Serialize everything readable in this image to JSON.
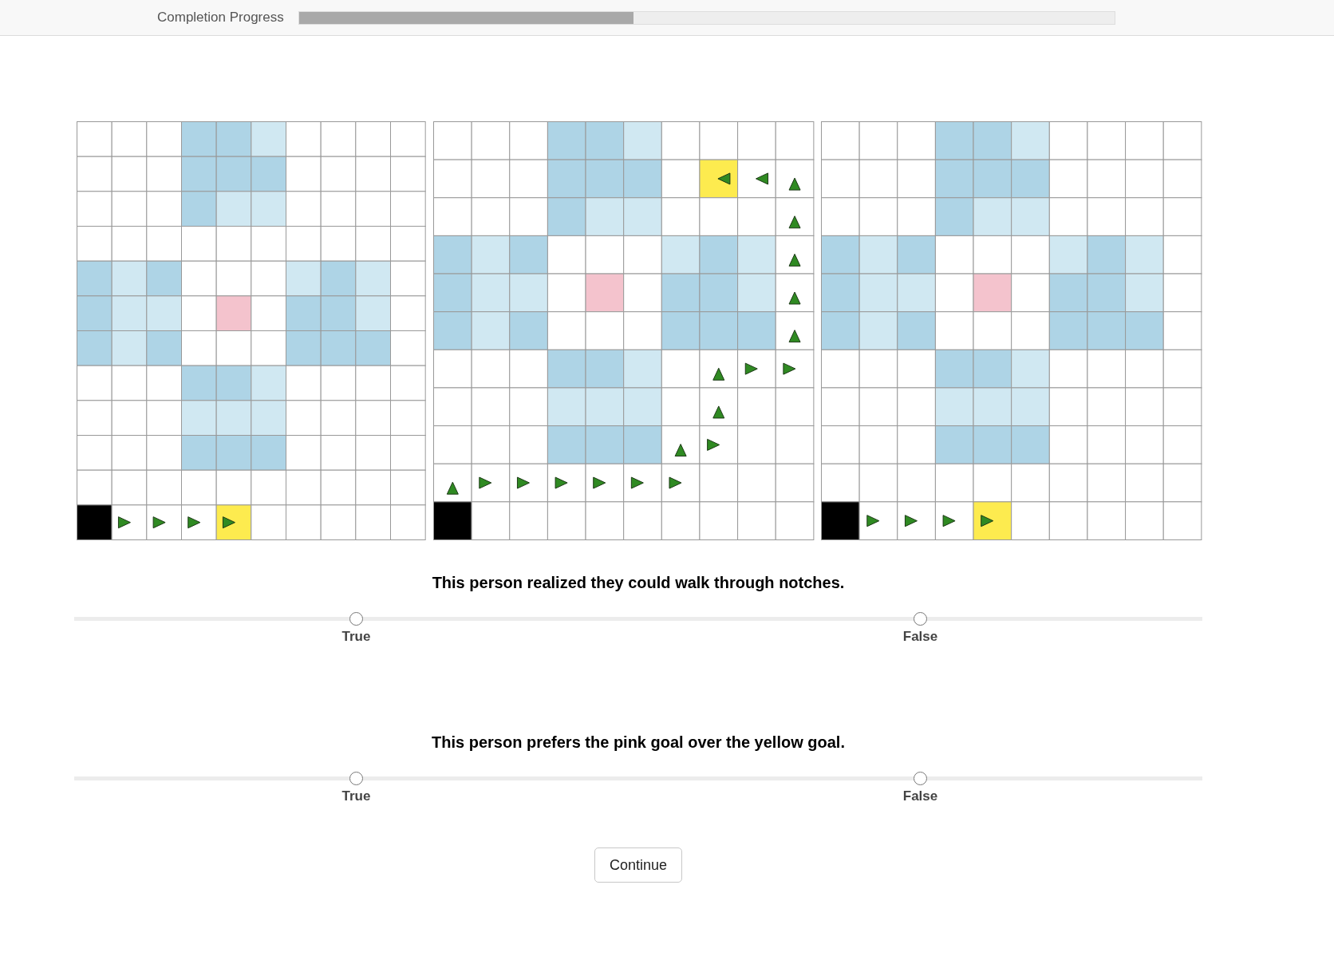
{
  "progress": {
    "label": "Completion Progress",
    "level": 0.41
  },
  "grids": [
    {
      "rows": [
        [
          {
            "color": "#ffffff",
            "kind": "plain"
          },
          {
            "color": "#ffffff",
            "kind": "plain"
          },
          {
            "color": "#ffffff",
            "kind": "plain"
          },
          {
            "color": "#aed4e6",
            "kind": "plain"
          },
          {
            "color": "#aed4e6",
            "kind": "plain"
          },
          {
            "color": "#d0e8f2",
            "kind": "plain"
          },
          {
            "color": "#ffffff",
            "kind": "plain"
          },
          {
            "color": "#ffffff",
            "kind": "plain"
          },
          {
            "color": "#ffffff",
            "kind": "plain"
          },
          {
            "color": "#ffffff",
            "kind": "plain"
          }
        ],
        [
          {
            "color": "#ffffff",
            "kind": "plain"
          },
          {
            "color": "#ffffff",
            "kind": "plain"
          },
          {
            "color": "#ffffff",
            "kind": "plain"
          },
          {
            "color": "#aed4e6",
            "kind": "plain"
          },
          {
            "color": "#aed4e6",
            "kind": "plain"
          },
          {
            "color": "#aed4e6",
            "kind": "plain"
          },
          {
            "color": "#ffffff",
            "kind": "plain"
          },
          {
            "color": "#ffffff",
            "kind": "plain"
          },
          {
            "color": "#ffffff",
            "kind": "plain"
          },
          {
            "color": "#ffffff",
            "kind": "plain"
          }
        ],
        [
          {
            "color": "#ffffff",
            "kind": "plain"
          },
          {
            "color": "#ffffff",
            "kind": "plain"
          },
          {
            "color": "#ffffff",
            "kind": "plain"
          },
          {
            "color": "#aed4e6",
            "kind": "plain"
          },
          {
            "color": "#d0e8f2",
            "kind": "plain"
          },
          {
            "color": "#d0e8f2",
            "kind": "plain"
          },
          {
            "color": "#ffffff",
            "kind": "plain"
          },
          {
            "color": "#ffffff",
            "kind": "plain"
          },
          {
            "color": "#ffffff",
            "kind": "plain"
          },
          {
            "color": "#ffffff",
            "kind": "plain"
          }
        ],
        [
          {
            "color": "#ffffff",
            "kind": "plain"
          },
          {
            "color": "#ffffff",
            "kind": "plain"
          },
          {
            "color": "#ffffff",
            "kind": "plain"
          },
          {
            "color": "#ffffff",
            "kind": "plain"
          },
          {
            "color": "#ffffff",
            "kind": "plain"
          },
          {
            "color": "#ffffff",
            "kind": "plain"
          },
          {
            "color": "#ffffff",
            "kind": "plain"
          },
          {
            "color": "#ffffff",
            "kind": "plain"
          },
          {
            "color": "#ffffff",
            "kind": "plain"
          },
          {
            "color": "#ffffff",
            "kind": "plain"
          }
        ],
        [
          {
            "color": "#aed4e6",
            "kind": "plain"
          },
          {
            "color": "#d0e8f2",
            "kind": "plain"
          },
          {
            "color": "#aed4e6",
            "kind": "plain"
          },
          {
            "color": "#ffffff",
            "kind": "plain"
          },
          {
            "color": "#ffffff",
            "kind": "plain"
          },
          {
            "color": "#ffffff",
            "kind": "plain"
          },
          {
            "color": "#d0e8f2",
            "kind": "plain"
          },
          {
            "color": "#aed4e6",
            "kind": "plain"
          },
          {
            "color": "#d0e8f2",
            "kind": "plain"
          },
          {
            "color": "#ffffff",
            "kind": "plain"
          }
        ],
        [
          {
            "color": "#aed4e6",
            "kind": "plain"
          },
          {
            "color": "#d0e8f2",
            "kind": "plain"
          },
          {
            "color": "#d0e8f2",
            "kind": "plain"
          },
          {
            "color": "#ffffff",
            "kind": "plain"
          },
          {
            "color": "#f4c3cd",
            "kind": "plain"
          },
          {
            "color": "#ffffff",
            "kind": "plain"
          },
          {
            "color": "#aed4e6",
            "kind": "plain"
          },
          {
            "color": "#aed4e6",
            "kind": "plain"
          },
          {
            "color": "#d0e8f2",
            "kind": "plain"
          },
          {
            "color": "#ffffff",
            "kind": "plain"
          }
        ],
        [
          {
            "color": "#aed4e6",
            "kind": "plain"
          },
          {
            "color": "#d0e8f2",
            "kind": "plain"
          },
          {
            "color": "#aed4e6",
            "kind": "plain"
          },
          {
            "color": "#ffffff",
            "kind": "plain"
          },
          {
            "color": "#ffffff",
            "kind": "plain"
          },
          {
            "color": "#ffffff",
            "kind": "plain"
          },
          {
            "color": "#aed4e6",
            "kind": "plain"
          },
          {
            "color": "#aed4e6",
            "kind": "plain"
          },
          {
            "color": "#aed4e6",
            "kind": "plain"
          },
          {
            "color": "#ffffff",
            "kind": "plain"
          }
        ],
        [
          {
            "color": "#ffffff",
            "kind": "plain"
          },
          {
            "color": "#ffffff",
            "kind": "plain"
          },
          {
            "color": "#ffffff",
            "kind": "plain"
          },
          {
            "color": "#aed4e6",
            "kind": "plain"
          },
          {
            "color": "#aed4e6",
            "kind": "plain"
          },
          {
            "color": "#d0e8f2",
            "kind": "plain"
          },
          {
            "color": "#ffffff",
            "kind": "plain"
          },
          {
            "color": "#ffffff",
            "kind": "plain"
          },
          {
            "color": "#ffffff",
            "kind": "plain"
          },
          {
            "color": "#ffffff",
            "kind": "plain"
          }
        ],
        [
          {
            "color": "#ffffff",
            "kind": "plain"
          },
          {
            "color": "#ffffff",
            "kind": "plain"
          },
          {
            "color": "#ffffff",
            "kind": "plain"
          },
          {
            "color": "#d0e8f2",
            "kind": "plain"
          },
          {
            "color": "#d0e8f2",
            "kind": "plain"
          },
          {
            "color": "#d0e8f2",
            "kind": "plain"
          },
          {
            "color": "#ffffff",
            "kind": "plain"
          },
          {
            "color": "#ffffff",
            "kind": "plain"
          },
          {
            "color": "#ffffff",
            "kind": "plain"
          },
          {
            "color": "#ffffff",
            "kind": "plain"
          }
        ],
        [
          {
            "color": "#ffffff",
            "kind": "plain"
          },
          {
            "color": "#ffffff",
            "kind": "plain"
          },
          {
            "color": "#ffffff",
            "kind": "plain"
          },
          {
            "color": "#aed4e6",
            "kind": "plain"
          },
          {
            "color": "#aed4e6",
            "kind": "plain"
          },
          {
            "color": "#aed4e6",
            "kind": "plain"
          },
          {
            "color": "#ffffff",
            "kind": "plain"
          },
          {
            "color": "#ffffff",
            "kind": "plain"
          },
          {
            "color": "#ffffff",
            "kind": "plain"
          },
          {
            "color": "#ffffff",
            "kind": "plain"
          }
        ],
        [
          {
            "color": "#ffffff",
            "kind": "plain"
          },
          {
            "color": "#ffffff",
            "kind": "plain"
          },
          {
            "color": "#ffffff",
            "kind": "plain"
          },
          {
            "color": "#ffffff",
            "kind": "plain"
          },
          {
            "color": "#ffffff",
            "kind": "plain"
          },
          {
            "color": "#ffffff",
            "kind": "plain"
          },
          {
            "color": "#ffffff",
            "kind": "plain"
          },
          {
            "color": "#ffffff",
            "kind": "plain"
          },
          {
            "color": "#ffffff",
            "kind": "plain"
          },
          {
            "color": "#ffffff",
            "kind": "plain"
          }
        ],
        [
          {
            "color": "#000000",
            "kind": "plain"
          },
          {
            "color": "#ffffff",
            "kind": "right"
          },
          {
            "color": "#ffffff",
            "kind": "right"
          },
          {
            "color": "#ffffff",
            "kind": "right"
          },
          {
            "color": "#fdeb4f",
            "kind": "right"
          },
          {
            "color": "#ffffff",
            "kind": "plain"
          },
          {
            "color": "#ffffff",
            "kind": "plain"
          },
          {
            "color": "#ffffff",
            "kind": "plain"
          },
          {
            "color": "#ffffff",
            "kind": "plain"
          },
          {
            "color": "#ffffff",
            "kind": "plain"
          }
        ]
      ]
    },
    {
      "rows": [
        [
          {
            "color": "#ffffff",
            "kind": "plain"
          },
          {
            "color": "#ffffff",
            "kind": "plain"
          },
          {
            "color": "#ffffff",
            "kind": "plain"
          },
          {
            "color": "#aed4e6",
            "kind": "plain"
          },
          {
            "color": "#aed4e6",
            "kind": "plain"
          },
          {
            "color": "#d0e8f2",
            "kind": "plain"
          },
          {
            "color": "#ffffff",
            "kind": "plain"
          },
          {
            "color": "#ffffff",
            "kind": "plain"
          },
          {
            "color": "#ffffff",
            "kind": "plain"
          },
          {
            "color": "#ffffff",
            "kind": "plain"
          }
        ],
        [
          {
            "color": "#ffffff",
            "kind": "plain"
          },
          {
            "color": "#ffffff",
            "kind": "plain"
          },
          {
            "color": "#ffffff",
            "kind": "plain"
          },
          {
            "color": "#aed4e6",
            "kind": "plain"
          },
          {
            "color": "#aed4e6",
            "kind": "plain"
          },
          {
            "color": "#aed4e6",
            "kind": "plain"
          },
          {
            "color": "#ffffff",
            "kind": "plain"
          },
          {
            "color": "#fdeb4f",
            "kind": "left"
          },
          {
            "color": "#ffffff",
            "kind": "left"
          },
          {
            "color": "#ffffff",
            "kind": "up"
          }
        ],
        [
          {
            "color": "#ffffff",
            "kind": "plain"
          },
          {
            "color": "#ffffff",
            "kind": "plain"
          },
          {
            "color": "#ffffff",
            "kind": "plain"
          },
          {
            "color": "#aed4e6",
            "kind": "plain"
          },
          {
            "color": "#d0e8f2",
            "kind": "plain"
          },
          {
            "color": "#d0e8f2",
            "kind": "plain"
          },
          {
            "color": "#ffffff",
            "kind": "plain"
          },
          {
            "color": "#ffffff",
            "kind": "plain"
          },
          {
            "color": "#ffffff",
            "kind": "plain"
          },
          {
            "color": "#ffffff",
            "kind": "up"
          }
        ],
        [
          {
            "color": "#aed4e6",
            "kind": "plain"
          },
          {
            "color": "#d0e8f2",
            "kind": "plain"
          },
          {
            "color": "#aed4e6",
            "kind": "plain"
          },
          {
            "color": "#ffffff",
            "kind": "plain"
          },
          {
            "color": "#ffffff",
            "kind": "plain"
          },
          {
            "color": "#ffffff",
            "kind": "plain"
          },
          {
            "color": "#d0e8f2",
            "kind": "plain"
          },
          {
            "color": "#aed4e6",
            "kind": "plain"
          },
          {
            "color": "#d0e8f2",
            "kind": "plain"
          },
          {
            "color": "#ffffff",
            "kind": "up"
          }
        ],
        [
          {
            "color": "#aed4e6",
            "kind": "plain"
          },
          {
            "color": "#d0e8f2",
            "kind": "plain"
          },
          {
            "color": "#d0e8f2",
            "kind": "plain"
          },
          {
            "color": "#ffffff",
            "kind": "plain"
          },
          {
            "color": "#f4c3cd",
            "kind": "plain"
          },
          {
            "color": "#ffffff",
            "kind": "plain"
          },
          {
            "color": "#aed4e6",
            "kind": "plain"
          },
          {
            "color": "#aed4e6",
            "kind": "plain"
          },
          {
            "color": "#d0e8f2",
            "kind": "plain"
          },
          {
            "color": "#ffffff",
            "kind": "up"
          }
        ],
        [
          {
            "color": "#aed4e6",
            "kind": "plain"
          },
          {
            "color": "#d0e8f2",
            "kind": "plain"
          },
          {
            "color": "#aed4e6",
            "kind": "plain"
          },
          {
            "color": "#ffffff",
            "kind": "plain"
          },
          {
            "color": "#ffffff",
            "kind": "plain"
          },
          {
            "color": "#ffffff",
            "kind": "plain"
          },
          {
            "color": "#aed4e6",
            "kind": "plain"
          },
          {
            "color": "#aed4e6",
            "kind": "plain"
          },
          {
            "color": "#aed4e6",
            "kind": "plain"
          },
          {
            "color": "#ffffff",
            "kind": "up"
          }
        ],
        [
          {
            "color": "#ffffff",
            "kind": "plain"
          },
          {
            "color": "#ffffff",
            "kind": "plain"
          },
          {
            "color": "#ffffff",
            "kind": "plain"
          },
          {
            "color": "#aed4e6",
            "kind": "plain"
          },
          {
            "color": "#aed4e6",
            "kind": "plain"
          },
          {
            "color": "#d0e8f2",
            "kind": "plain"
          },
          {
            "color": "#ffffff",
            "kind": "plain"
          },
          {
            "color": "#ffffff",
            "kind": "up"
          },
          {
            "color": "#ffffff",
            "kind": "right"
          },
          {
            "color": "#ffffff",
            "kind": "right"
          }
        ],
        [
          {
            "color": "#ffffff",
            "kind": "plain"
          },
          {
            "color": "#ffffff",
            "kind": "plain"
          },
          {
            "color": "#ffffff",
            "kind": "plain"
          },
          {
            "color": "#d0e8f2",
            "kind": "plain"
          },
          {
            "color": "#d0e8f2",
            "kind": "plain"
          },
          {
            "color": "#d0e8f2",
            "kind": "plain"
          },
          {
            "color": "#ffffff",
            "kind": "plain"
          },
          {
            "color": "#ffffff",
            "kind": "up"
          },
          {
            "color": "#ffffff",
            "kind": "plain"
          },
          {
            "color": "#ffffff",
            "kind": "plain"
          }
        ],
        [
          {
            "color": "#ffffff",
            "kind": "plain"
          },
          {
            "color": "#ffffff",
            "kind": "plain"
          },
          {
            "color": "#ffffff",
            "kind": "plain"
          },
          {
            "color": "#aed4e6",
            "kind": "plain"
          },
          {
            "color": "#aed4e6",
            "kind": "plain"
          },
          {
            "color": "#aed4e6",
            "kind": "plain"
          },
          {
            "color": "#ffffff",
            "kind": "up"
          },
          {
            "color": "#ffffff",
            "kind": "right"
          },
          {
            "color": "#ffffff",
            "kind": "plain"
          },
          {
            "color": "#ffffff",
            "kind": "plain"
          }
        ],
        [
          {
            "color": "#ffffff",
            "kind": "up"
          },
          {
            "color": "#ffffff",
            "kind": "right"
          },
          {
            "color": "#ffffff",
            "kind": "right"
          },
          {
            "color": "#ffffff",
            "kind": "right"
          },
          {
            "color": "#ffffff",
            "kind": "right"
          },
          {
            "color": "#ffffff",
            "kind": "right"
          },
          {
            "color": "#ffffff",
            "kind": "right"
          },
          {
            "color": "#ffffff",
            "kind": "plain"
          },
          {
            "color": "#ffffff",
            "kind": "plain"
          },
          {
            "color": "#ffffff",
            "kind": "plain"
          }
        ],
        [
          {
            "color": "#000000",
            "kind": "plain"
          },
          {
            "color": "#ffffff",
            "kind": "plain"
          },
          {
            "color": "#ffffff",
            "kind": "plain"
          },
          {
            "color": "#ffffff",
            "kind": "plain"
          },
          {
            "color": "#ffffff",
            "kind": "plain"
          },
          {
            "color": "#ffffff",
            "kind": "plain"
          },
          {
            "color": "#ffffff",
            "kind": "plain"
          },
          {
            "color": "#ffffff",
            "kind": "plain"
          },
          {
            "color": "#ffffff",
            "kind": "plain"
          },
          {
            "color": "#ffffff",
            "kind": "plain"
          }
        ]
      ]
    },
    {
      "rows": [
        [
          {
            "color": "#ffffff",
            "kind": "plain"
          },
          {
            "color": "#ffffff",
            "kind": "plain"
          },
          {
            "color": "#ffffff",
            "kind": "plain"
          },
          {
            "color": "#aed4e6",
            "kind": "plain"
          },
          {
            "color": "#aed4e6",
            "kind": "plain"
          },
          {
            "color": "#d0e8f2",
            "kind": "plain"
          },
          {
            "color": "#ffffff",
            "kind": "plain"
          },
          {
            "color": "#ffffff",
            "kind": "plain"
          },
          {
            "color": "#ffffff",
            "kind": "plain"
          },
          {
            "color": "#ffffff",
            "kind": "plain"
          }
        ],
        [
          {
            "color": "#ffffff",
            "kind": "plain"
          },
          {
            "color": "#ffffff",
            "kind": "plain"
          },
          {
            "color": "#ffffff",
            "kind": "plain"
          },
          {
            "color": "#aed4e6",
            "kind": "plain"
          },
          {
            "color": "#aed4e6",
            "kind": "plain"
          },
          {
            "color": "#aed4e6",
            "kind": "plain"
          },
          {
            "color": "#ffffff",
            "kind": "plain"
          },
          {
            "color": "#ffffff",
            "kind": "plain"
          },
          {
            "color": "#ffffff",
            "kind": "plain"
          },
          {
            "color": "#ffffff",
            "kind": "plain"
          }
        ],
        [
          {
            "color": "#ffffff",
            "kind": "plain"
          },
          {
            "color": "#ffffff",
            "kind": "plain"
          },
          {
            "color": "#ffffff",
            "kind": "plain"
          },
          {
            "color": "#aed4e6",
            "kind": "plain"
          },
          {
            "color": "#d0e8f2",
            "kind": "plain"
          },
          {
            "color": "#d0e8f2",
            "kind": "plain"
          },
          {
            "color": "#ffffff",
            "kind": "plain"
          },
          {
            "color": "#ffffff",
            "kind": "plain"
          },
          {
            "color": "#ffffff",
            "kind": "plain"
          },
          {
            "color": "#ffffff",
            "kind": "plain"
          }
        ],
        [
          {
            "color": "#aed4e6",
            "kind": "plain"
          },
          {
            "color": "#d0e8f2",
            "kind": "plain"
          },
          {
            "color": "#aed4e6",
            "kind": "plain"
          },
          {
            "color": "#ffffff",
            "kind": "plain"
          },
          {
            "color": "#ffffff",
            "kind": "plain"
          },
          {
            "color": "#ffffff",
            "kind": "plain"
          },
          {
            "color": "#d0e8f2",
            "kind": "plain"
          },
          {
            "color": "#aed4e6",
            "kind": "plain"
          },
          {
            "color": "#d0e8f2",
            "kind": "plain"
          },
          {
            "color": "#ffffff",
            "kind": "plain"
          }
        ],
        [
          {
            "color": "#aed4e6",
            "kind": "plain"
          },
          {
            "color": "#d0e8f2",
            "kind": "plain"
          },
          {
            "color": "#d0e8f2",
            "kind": "plain"
          },
          {
            "color": "#ffffff",
            "kind": "plain"
          },
          {
            "color": "#f4c3cd",
            "kind": "plain"
          },
          {
            "color": "#ffffff",
            "kind": "plain"
          },
          {
            "color": "#aed4e6",
            "kind": "plain"
          },
          {
            "color": "#aed4e6",
            "kind": "plain"
          },
          {
            "color": "#d0e8f2",
            "kind": "plain"
          },
          {
            "color": "#ffffff",
            "kind": "plain"
          }
        ],
        [
          {
            "color": "#aed4e6",
            "kind": "plain"
          },
          {
            "color": "#d0e8f2",
            "kind": "plain"
          },
          {
            "color": "#aed4e6",
            "kind": "plain"
          },
          {
            "color": "#ffffff",
            "kind": "plain"
          },
          {
            "color": "#ffffff",
            "kind": "plain"
          },
          {
            "color": "#ffffff",
            "kind": "plain"
          },
          {
            "color": "#aed4e6",
            "kind": "plain"
          },
          {
            "color": "#aed4e6",
            "kind": "plain"
          },
          {
            "color": "#aed4e6",
            "kind": "plain"
          },
          {
            "color": "#ffffff",
            "kind": "plain"
          }
        ],
        [
          {
            "color": "#ffffff",
            "kind": "plain"
          },
          {
            "color": "#ffffff",
            "kind": "plain"
          },
          {
            "color": "#ffffff",
            "kind": "plain"
          },
          {
            "color": "#aed4e6",
            "kind": "plain"
          },
          {
            "color": "#aed4e6",
            "kind": "plain"
          },
          {
            "color": "#d0e8f2",
            "kind": "plain"
          },
          {
            "color": "#ffffff",
            "kind": "plain"
          },
          {
            "color": "#ffffff",
            "kind": "plain"
          },
          {
            "color": "#ffffff",
            "kind": "plain"
          },
          {
            "color": "#ffffff",
            "kind": "plain"
          }
        ],
        [
          {
            "color": "#ffffff",
            "kind": "plain"
          },
          {
            "color": "#ffffff",
            "kind": "plain"
          },
          {
            "color": "#ffffff",
            "kind": "plain"
          },
          {
            "color": "#d0e8f2",
            "kind": "plain"
          },
          {
            "color": "#d0e8f2",
            "kind": "plain"
          },
          {
            "color": "#d0e8f2",
            "kind": "plain"
          },
          {
            "color": "#ffffff",
            "kind": "plain"
          },
          {
            "color": "#ffffff",
            "kind": "plain"
          },
          {
            "color": "#ffffff",
            "kind": "plain"
          },
          {
            "color": "#ffffff",
            "kind": "plain"
          }
        ],
        [
          {
            "color": "#ffffff",
            "kind": "plain"
          },
          {
            "color": "#ffffff",
            "kind": "plain"
          },
          {
            "color": "#ffffff",
            "kind": "plain"
          },
          {
            "color": "#aed4e6",
            "kind": "plain"
          },
          {
            "color": "#aed4e6",
            "kind": "plain"
          },
          {
            "color": "#aed4e6",
            "kind": "plain"
          },
          {
            "color": "#ffffff",
            "kind": "plain"
          },
          {
            "color": "#ffffff",
            "kind": "plain"
          },
          {
            "color": "#ffffff",
            "kind": "plain"
          },
          {
            "color": "#ffffff",
            "kind": "plain"
          }
        ],
        [
          {
            "color": "#ffffff",
            "kind": "plain"
          },
          {
            "color": "#ffffff",
            "kind": "plain"
          },
          {
            "color": "#ffffff",
            "kind": "plain"
          },
          {
            "color": "#ffffff",
            "kind": "plain"
          },
          {
            "color": "#ffffff",
            "kind": "plain"
          },
          {
            "color": "#ffffff",
            "kind": "plain"
          },
          {
            "color": "#ffffff",
            "kind": "plain"
          },
          {
            "color": "#ffffff",
            "kind": "plain"
          },
          {
            "color": "#ffffff",
            "kind": "plain"
          },
          {
            "color": "#ffffff",
            "kind": "plain"
          }
        ],
        [
          {
            "color": "#000000",
            "kind": "plain"
          },
          {
            "color": "#ffffff",
            "kind": "right"
          },
          {
            "color": "#ffffff",
            "kind": "right"
          },
          {
            "color": "#ffffff",
            "kind": "right"
          },
          {
            "color": "#fdeb4f",
            "kind": "right"
          },
          {
            "color": "#ffffff",
            "kind": "plain"
          },
          {
            "color": "#ffffff",
            "kind": "plain"
          },
          {
            "color": "#ffffff",
            "kind": "plain"
          },
          {
            "color": "#ffffff",
            "kind": "plain"
          },
          {
            "color": "#ffffff",
            "kind": "plain"
          }
        ]
      ]
    }
  ],
  "questions": [
    {
      "text": "This person realized they could walk through notches.",
      "options": [
        {
          "label": "True",
          "selected": false
        },
        {
          "label": "False",
          "selected": false
        }
      ]
    },
    {
      "text": "This person prefers the pink goal over the yellow goal.",
      "options": [
        {
          "label": "True",
          "selected": false
        },
        {
          "label": "False",
          "selected": false
        }
      ]
    }
  ],
  "continue_button": {
    "label": "Continue"
  }
}
